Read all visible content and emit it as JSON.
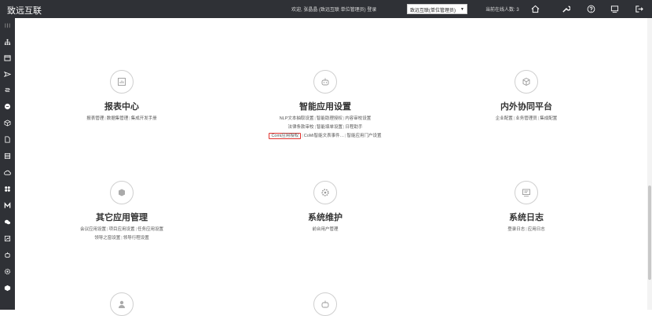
{
  "header": {
    "brand": "致远互联",
    "welcome": "欢迎, 张晶晶 (致远互联 单位管理员) 登录",
    "org_select": "致远互联(单位管理员)",
    "online": "当前在线人数: 3"
  },
  "cards": {
    "report": {
      "title": "报表中心",
      "links": [
        "报表管理",
        "数据集管理",
        "集成开发手册"
      ]
    },
    "smart": {
      "title": "智能应用设置",
      "row1": [
        "NLP文本抽取设置",
        "智能助理授权",
        "内容审校设置"
      ],
      "row2": [
        "法律条款审校",
        "智能填单设置",
        "日程助手"
      ],
      "row3": [
        "Comi应用授权",
        "CoMi智能文表事件…",
        "智能应用门户设置"
      ]
    },
    "collab": {
      "title": "内外协同平台",
      "links": [
        "企业配置",
        "业务管理员",
        "集成配置"
      ]
    },
    "other": {
      "title": "其它应用管理",
      "row1": [
        "会议应用设置",
        "项目应用设置",
        "任务应用设置"
      ],
      "row2": [
        "领导之窗设置",
        "领导行程设置"
      ]
    },
    "maint": {
      "title": "系统维护",
      "links": [
        "前台用户管理"
      ]
    },
    "log": {
      "title": "系统日志",
      "links": [
        "登录日志",
        "应用日志"
      ]
    }
  },
  "icons": {
    "top": [
      "home-icon",
      "wrench-icon",
      "help-icon",
      "monitor-icon",
      "logout-icon"
    ],
    "sidebar": [
      "menu-icon",
      "org-icon",
      "calendar-icon",
      "send-icon",
      "flow-icon",
      "chat-icon",
      "cube-icon",
      "doc-icon",
      "list-icon",
      "cloud-icon",
      "apps-icon",
      "mail-icon",
      "message-icon",
      "chart-icon",
      "robot-icon",
      "settings-icon",
      "shield-icon"
    ]
  },
  "colors": {
    "topbar": "#2f3136",
    "highlight": "#e0332f"
  }
}
